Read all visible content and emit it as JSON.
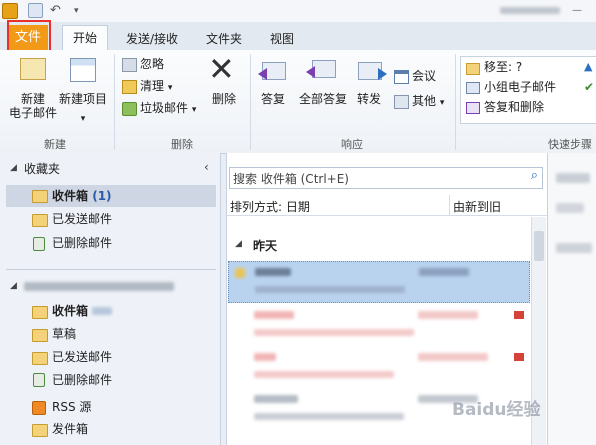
{
  "tabs": {
    "file": "文件",
    "home": "开始",
    "send_receive": "发送/接收",
    "folder": "文件夹",
    "view": "视图"
  },
  "ribbon": {
    "new": {
      "new_email": "新建\n电子邮件",
      "new_items": "新建项目",
      "group": "新建"
    },
    "delete": {
      "ignore": "忽略",
      "clean_up": "清理",
      "junk": "垃圾邮件",
      "delete": "删除",
      "group": "删除"
    },
    "respond": {
      "reply": "答复",
      "reply_all": "全部答复",
      "forward": "转发",
      "meeting": "会议",
      "more": "其他",
      "group": "响应"
    },
    "quick_steps": {
      "move_to": "移至: ?",
      "team_email": "小组电子邮件",
      "reply_delete": "答复和删除",
      "group": "快速步骤"
    }
  },
  "nav": {
    "favorites_header": "收藏夹",
    "favorites": [
      {
        "label": "收件箱",
        "count": "(1)"
      },
      {
        "label": "已发送邮件"
      },
      {
        "label": "已删除邮件"
      }
    ],
    "account": [
      {
        "label": "收件箱"
      },
      {
        "label": "草稿"
      },
      {
        "label": "已发送邮件"
      },
      {
        "label": "已删除邮件"
      },
      {
        "label": "RSS 源"
      },
      {
        "label": "发件箱"
      }
    ]
  },
  "list": {
    "search_placeholder": "搜索 收件箱 (Ctrl+E)",
    "sort_label": "排列方式: 日期",
    "sort_order": "由新到旧",
    "group_yesterday": "昨天"
  },
  "watermark": "Baidu经验",
  "colors": {
    "file_tab": "#f29a18",
    "highlight": "#e8312b",
    "selected_row": "#b9d3ef"
  }
}
